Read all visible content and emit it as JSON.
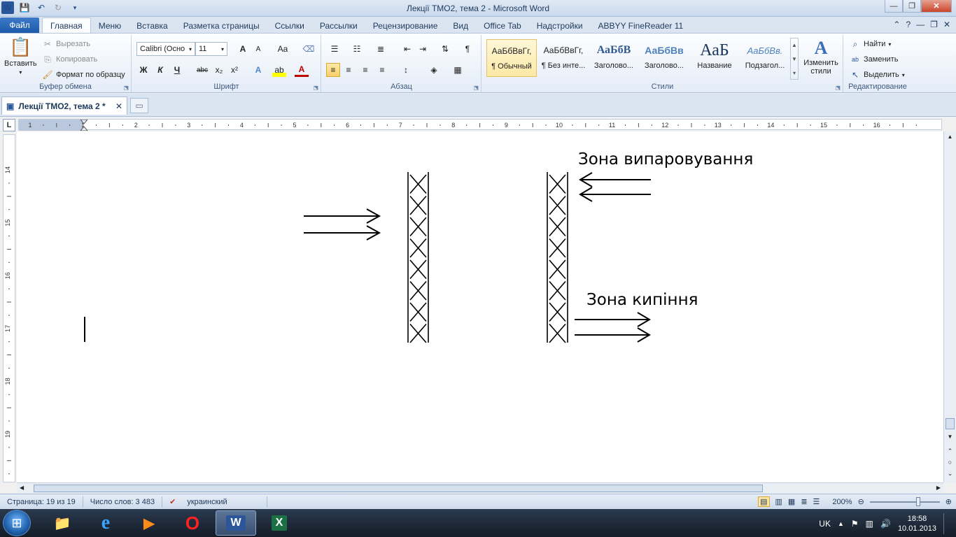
{
  "app": {
    "window_title": "Лекції ТМО2, тема 2  -  Microsoft Word",
    "window_controls": [
      "—",
      "❐",
      "✕"
    ]
  },
  "ribbon_tabs": {
    "file": "Файл",
    "items": [
      "Главная",
      "Меню",
      "Вставка",
      "Разметка страницы",
      "Ссылки",
      "Рассылки",
      "Рецензирование",
      "Вид",
      "Office Tab",
      "Надстройки",
      "ABBYY FineReader 11"
    ]
  },
  "clipboard": {
    "paste": "Вставить",
    "cut": "Вырезать",
    "copy": "Копировать",
    "format_painter": "Формат по образцу",
    "label": "Буфер обмена"
  },
  "font": {
    "name": "Calibri (Осно",
    "size": "11",
    "label": "Шрифт",
    "bold": "Ж",
    "italic": "К",
    "underline": "Ч",
    "strike": "abc",
    "sub": "x₂",
    "sup": "x²",
    "grow": "A",
    "shrink": "A",
    "case": "Aa"
  },
  "paragraph": {
    "label": "Абзац",
    "pilcrow": "¶"
  },
  "styles": {
    "label": "Стили",
    "items": [
      {
        "sample": "АаБбВвГг,",
        "name": "¶ Обычный"
      },
      {
        "sample": "АаБбВвГг,",
        "name": "¶ Без инте..."
      },
      {
        "sample": "АаБбВ",
        "name": "Заголово..."
      },
      {
        "sample": "АаБбВв",
        "name": "Заголово..."
      },
      {
        "sample": "АаБ",
        "name": "Название"
      },
      {
        "sample": "АаБбВв.",
        "name": "Подзагол..."
      }
    ],
    "change": "Изменить стили"
  },
  "editing": {
    "label": "Редактирование",
    "find": "Найти",
    "replace": "Заменить",
    "select": "Выделить"
  },
  "document_tab": {
    "title": "Лекції ТМО2, тема 2 *"
  },
  "ruler": {
    "corner": "L",
    "h_ticks": [
      "1",
      "1",
      "2",
      "3",
      "4",
      "5",
      "6",
      "7",
      "8",
      "9",
      "10",
      "11",
      "12",
      "13",
      "14",
      "15",
      "16"
    ],
    "v_ticks": [
      "14",
      "15",
      "16",
      "17",
      "18",
      "19"
    ]
  },
  "diagram": {
    "zone_evaporation": "Зона випаровування",
    "zone_boiling": "Зона кипіння"
  },
  "status": {
    "page": "Страница: 19 из 19",
    "words": "Число слов: 3 483",
    "language": "украинский",
    "zoom": "200%"
  },
  "taskbar": {
    "lang": "UK",
    "time": "18:58",
    "date": "10.01.2013"
  }
}
